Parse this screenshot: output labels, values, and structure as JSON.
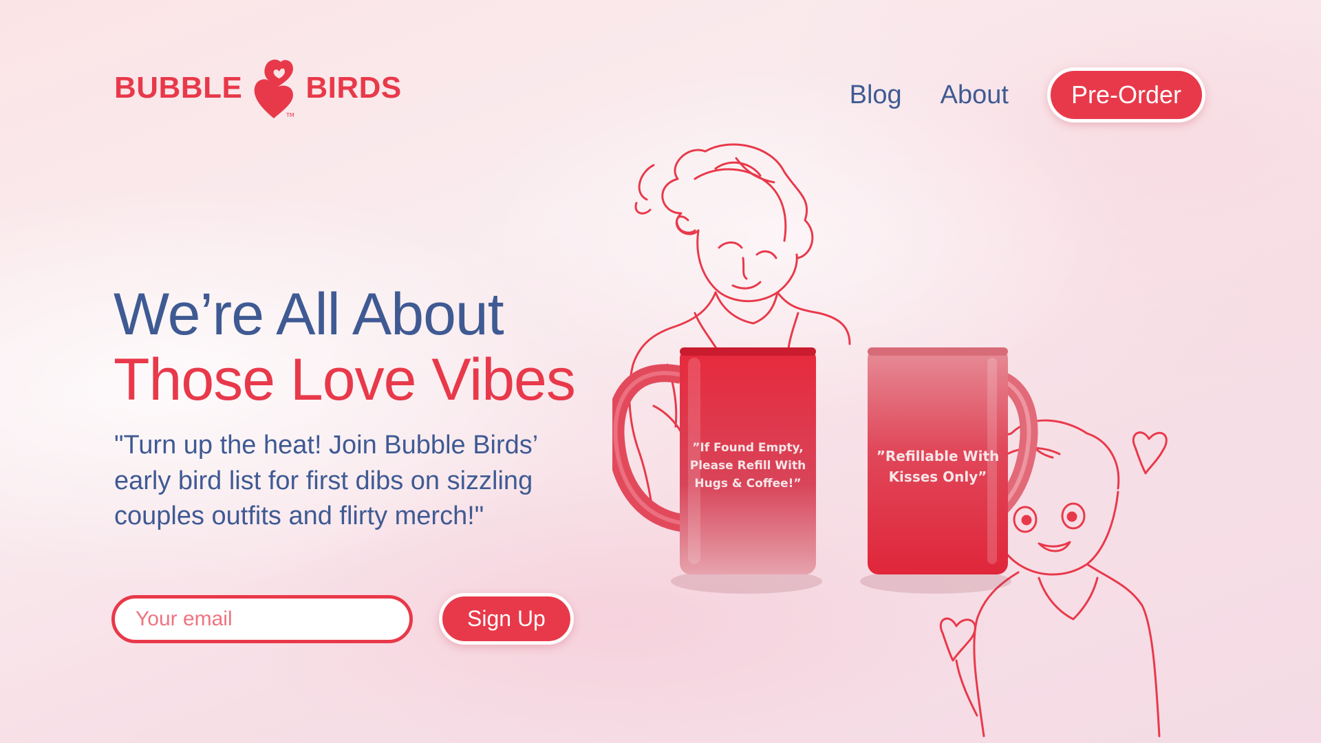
{
  "header": {
    "logo": {
      "word1": "BUBBLE",
      "word2": "BIRDS",
      "trademark": "TM"
    },
    "nav": [
      {
        "label": "Blog"
      },
      {
        "label": "About"
      }
    ],
    "cta_label": "Pre-Order"
  },
  "hero": {
    "title_line1": "We’re All About",
    "title_line2": "Those Love Vibes",
    "subtitle": "\"Turn up the heat! Join Bubble Birds’ early bird list for first dibs on sizzling couples outfits and flirty merch!\"",
    "email_placeholder": "Your email",
    "signup_label": "Sign Up"
  },
  "mugs": [
    {
      "lines": [
        "”If Found Empty,",
        "Please Refill With",
        "Hugs & Coffee!”"
      ]
    },
    {
      "lines": [
        "”Refillable With",
        "Kisses Only”"
      ]
    }
  ],
  "colors": {
    "brand_red": "#e8394a",
    "navy": "#3f5a93",
    "background": "#f9e6ea"
  }
}
